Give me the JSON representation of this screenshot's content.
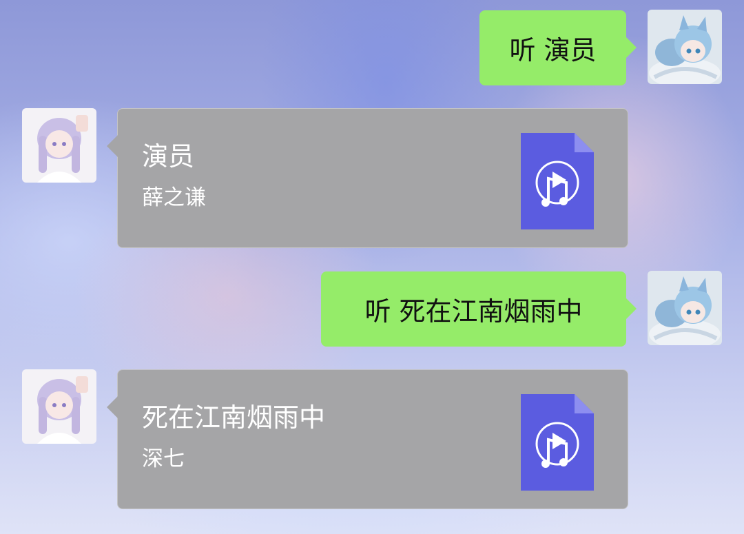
{
  "colors": {
    "outgoing_bubble": "#95ec69",
    "incoming_card": "#a5a5a7",
    "music_icon": "#5b5ce0"
  },
  "messages": [
    {
      "type": "outgoing",
      "text": "听 演员",
      "avatar": "anime-cat-girl-avatar"
    },
    {
      "type": "music-card",
      "title": "演员",
      "artist": "薛之谦",
      "icon": "music-file-icon",
      "avatar": "anime-girl-avatar"
    },
    {
      "type": "outgoing",
      "text": "听 死在江南烟雨中",
      "avatar": "anime-cat-girl-avatar"
    },
    {
      "type": "music-card",
      "title": "死在江南烟雨中",
      "artist": "深七",
      "icon": "music-file-icon",
      "avatar": "anime-girl-avatar"
    }
  ]
}
